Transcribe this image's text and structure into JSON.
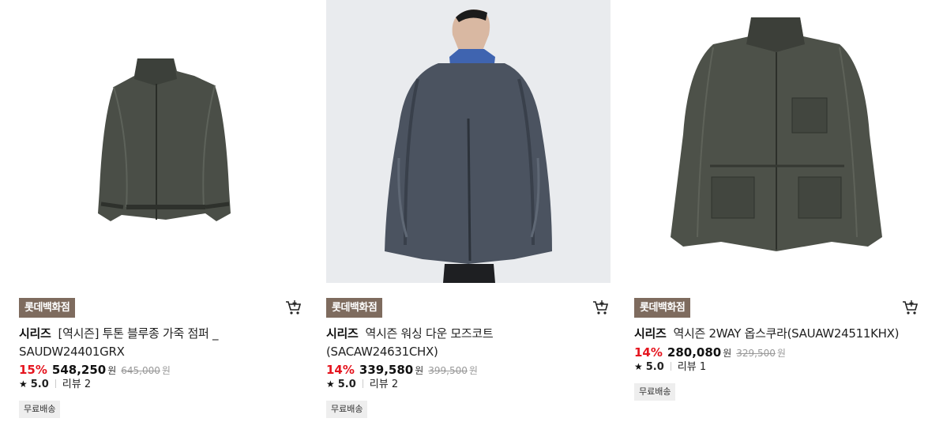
{
  "products": [
    {
      "badge": "롯데백화점",
      "brand": "시리즈",
      "name": "[역시즌] 투톤 블루종 가죽 점퍼 _ SAUDW24401GRX",
      "discount": "15%",
      "price": "548,250",
      "currency": "원",
      "original_price": "645,000",
      "original_currency": "원",
      "star": "★",
      "rating": "5.0",
      "reviews": "리뷰 2",
      "shipping_tag": "무료배송",
      "image_icon": "leather-jacket-image"
    },
    {
      "badge": "롯데백화점",
      "brand": "시리즈",
      "name": "역시즌 워싱 다운 모즈코트 (SACAW24631CHX)",
      "discount": "14%",
      "price": "339,580",
      "currency": "원",
      "original_price": "399,500",
      "original_currency": "원",
      "star": "★",
      "rating": "5.0",
      "reviews": "리뷰 2",
      "shipping_tag": "무료배송",
      "image_icon": "model-down-coat-image"
    },
    {
      "badge": "롯데백화점",
      "brand": "시리즈",
      "name": "역시즌 2WAY 옵스쿠라(SAUAW24511KHX)",
      "discount": "14%",
      "price": "280,080",
      "currency": "원",
      "original_price": "329,500",
      "original_currency": "원",
      "star": "★",
      "rating": "5.0",
      "reviews": "리뷰 1",
      "shipping_tag": "무료배송",
      "image_icon": "field-jacket-image"
    }
  ],
  "colors": {
    "badge_bg": "#7e6b5e",
    "discount": "#e5141e",
    "tag_bg": "#eeeeee"
  },
  "icons": {
    "cart": "cart-icon",
    "star": "star-icon"
  }
}
